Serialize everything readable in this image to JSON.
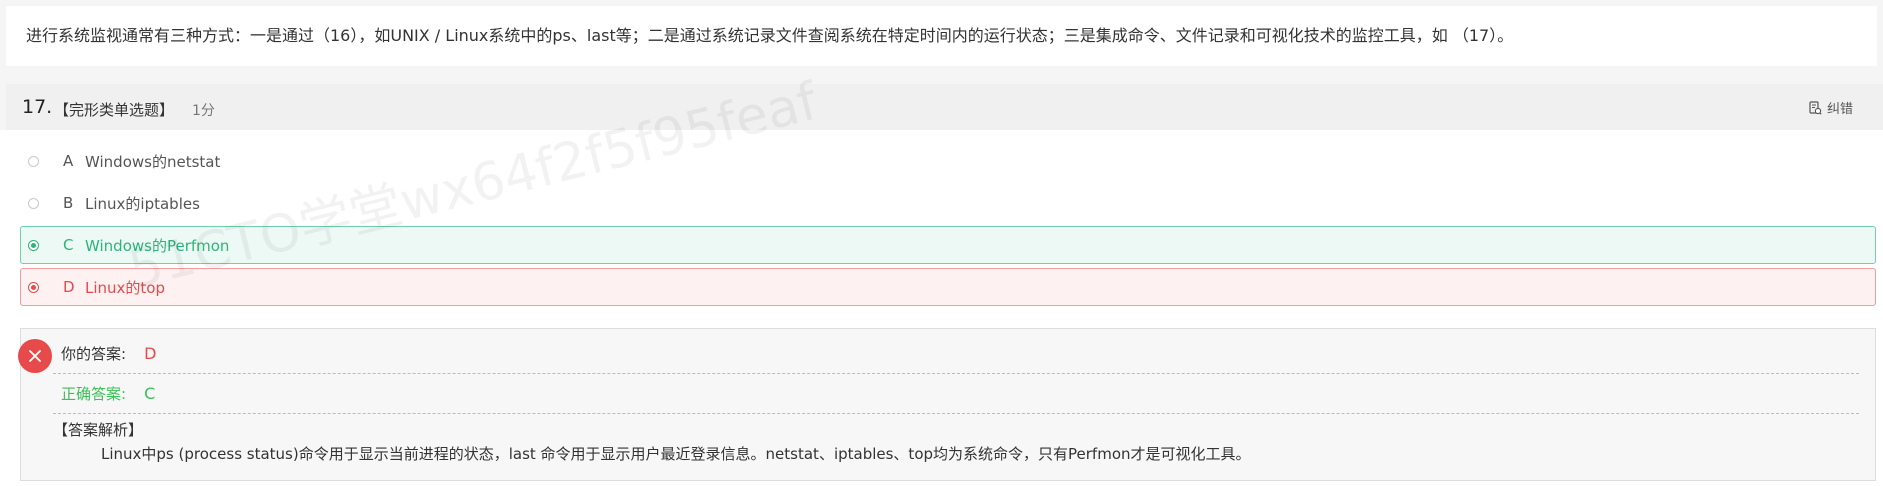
{
  "question_stem": "进行系统监视通常有三种方式：一是通过（16），如UNIX / Linux系统中的ps、last等；二是通过系统记录文件查阅系统在特定时间内的运行状态；三是集成命令、文件记录和可视化技术的监控工具，如 （17）。",
  "question": {
    "number": "17.",
    "type": "【完形类单选题】",
    "score": "1分",
    "correct_button_label": "纠错"
  },
  "options": [
    {
      "letter": "A",
      "text": "Windows的netstat",
      "state": "normal"
    },
    {
      "letter": "B",
      "text": "Linux的iptables",
      "state": "normal"
    },
    {
      "letter": "C",
      "text": "Windows的Perfmon",
      "state": "correct"
    },
    {
      "letter": "D",
      "text": "Linux的top",
      "state": "wrong-selected"
    }
  ],
  "watermark": "51CTO学堂wx64f2f5f95feaf",
  "answer": {
    "your_label": "你的答案:",
    "your_value": "D",
    "correct_label": "正确答案:",
    "correct_value": "C",
    "analysis_title": "【答案解析】",
    "analysis_text": "Linux中ps (process status)命令用于显示当前进程的状态，last 命令用于显示用户最近登录信息。netstat、iptables、top均为系统命令，只有Perfmon才是可视化工具。"
  },
  "colors": {
    "correct": "#2bb57a",
    "wrong": "#e64a4a",
    "correct_answer_text": "#3cbf58"
  }
}
